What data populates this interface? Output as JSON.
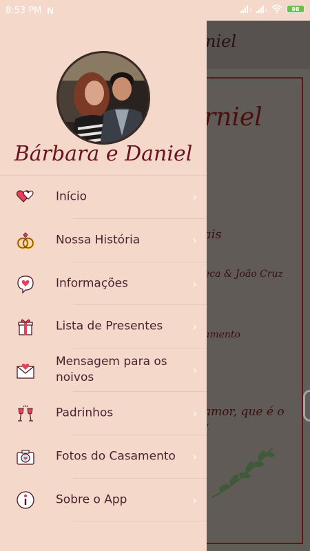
{
  "status_bar": {
    "time": "8:53 PM",
    "notification_icon": "N",
    "battery": "98"
  },
  "drawer": {
    "couple_name": "Bárbara e Daniel",
    "menu": [
      {
        "label": "Início",
        "icon": "hearts-icon"
      },
      {
        "label": "Nossa História",
        "icon": "rings-icon"
      },
      {
        "label": "Informações",
        "icon": "heart-speech-bubble-icon"
      },
      {
        "label": "Lista de Presentes",
        "icon": "gift-icon"
      },
      {
        "label": "Mensagem para os noivos",
        "icon": "envelope-heart-icon"
      },
      {
        "label": "Padrinhos",
        "icon": "champagne-glasses-icon"
      },
      {
        "label": "Fotos do Casamento",
        "icon": "camera-icon"
      },
      {
        "label": "Sobre o App",
        "icon": "info-icon"
      }
    ],
    "chevron": "›"
  },
  "background_page": {
    "header_title": "niel",
    "card_name": "rniel",
    "line1": "ais",
    "line2": "eca & João Cruz",
    "line3": "amento",
    "line4": "amor, que é o",
    "line5": "”"
  },
  "colors": {
    "drawer_bg": "#f4d8c9",
    "accent": "#6b1122",
    "label": "#4a2230"
  }
}
